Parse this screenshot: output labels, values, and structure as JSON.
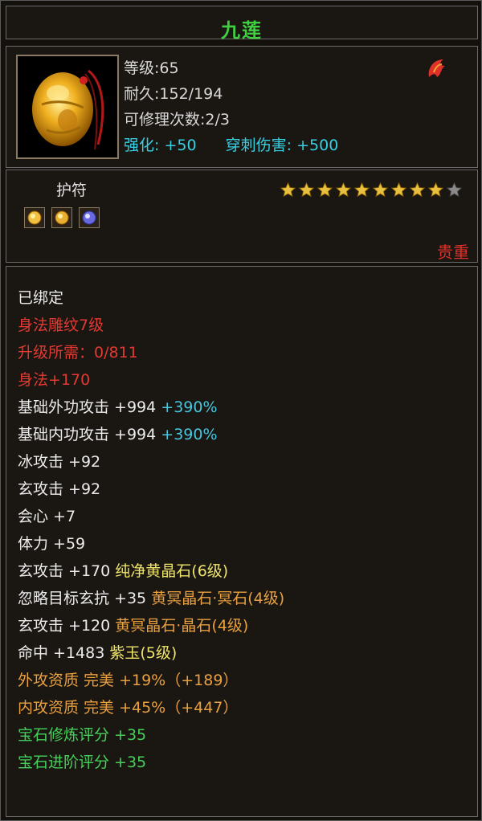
{
  "item": {
    "name": "九莲",
    "level": "等级:65",
    "durability": "耐久:152/194",
    "repair_count": "可修理次数:2/3",
    "enhance_label": "强化:",
    "enhance_value": "+50",
    "pierce_label": "穿刺伤害:",
    "pierce_value": "+500",
    "type": "护符",
    "rarity": "贵重",
    "stars_filled": 9,
    "stars_total": 10
  },
  "colors": {
    "title": "#3fd040",
    "enhance": "#36d0e4",
    "red": "#e03a32",
    "gold": "#eee46a",
    "orange": "#e8a040",
    "green": "#46d05a"
  },
  "icons": {
    "item": "jade-amulet-icon",
    "corner": "dragon-emblem-icon",
    "star": "star-icon",
    "gems": [
      "yellow-gem-icon",
      "yellow-gem-icon",
      "purple-gem-icon"
    ]
  },
  "stats": {
    "bound": "已绑定",
    "engrave": "身法雕纹7级",
    "upgrade": "升级所需：0/811",
    "agility": "身法+170",
    "outer_attack": "基础外功攻击 +994",
    "outer_attack_pct": "+390%",
    "inner_attack": "基础内功攻击 +994",
    "inner_attack_pct": "+390%",
    "ice_attack": "冰攻击 +92",
    "xuan_attack": "玄攻击 +92",
    "critical": "会心 +7",
    "stamina": "体力 +59",
    "gem1_stat": "玄攻击 +170",
    "gem1_name": "纯净黄晶石(6级)",
    "gem2_stat": "忽略目标玄抗 +35",
    "gem2_name": "黄冥晶石·冥石(4级)",
    "gem3_stat": "玄攻击 +120",
    "gem3_name": "黄冥晶石·晶石(4级)",
    "gem4_stat": "命中 +1483",
    "gem4_name": "紫玉(5级)",
    "outer_quality": "外攻资质  完美 +19%（+189）",
    "inner_quality": "内攻资质  完美 +45%（+447）",
    "gem_refine": "宝石修炼评分 +35",
    "gem_advance": "宝石进阶评分 +35"
  }
}
